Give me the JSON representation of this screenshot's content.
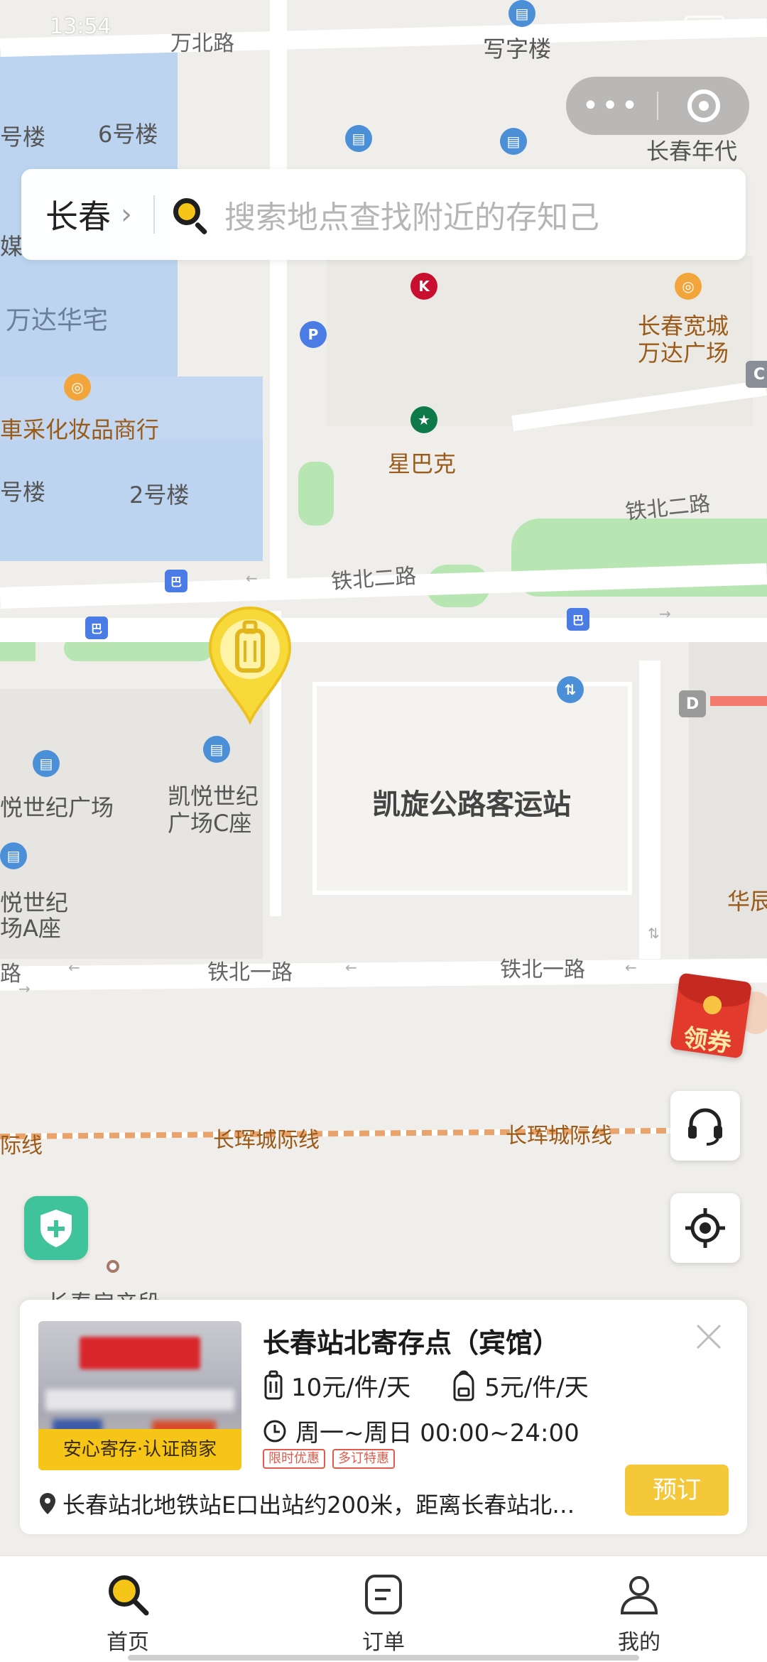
{
  "status_bar": {
    "time": "13:54"
  },
  "search": {
    "city": "长春",
    "placeholder": "搜索地点查找附近的存知己"
  },
  "map": {
    "labels": {
      "wanbei_road": "万北路",
      "office": "写字楼",
      "bldg_6": "6号楼",
      "bldg_x_left": "号楼",
      "changchun_niandai": "长春年代",
      "wanda_huazhai": "万达华宅",
      "kuancheng_wanda": "长春宽城万达广场",
      "kuancheng_line1": "长春宽城",
      "kuancheng_line2": "万达广场",
      "cosmetics": "車采化妆品商行",
      "starbucks": "星巴克",
      "bldg_2": "2号楼",
      "bldg_left2": "号楼",
      "tiebei_2_road": "铁北二路",
      "kaiyue_plaza": "悦世纪广场",
      "kaiyue_c_line1": "凯悦世纪",
      "kaiyue_c_line2": "广场C座",
      "kaixuan_station": "凯旋公路客运站",
      "kaiyue_a_line1": "悦世纪",
      "kaiyue_a_line2": "场A座",
      "huachen": "华辰",
      "tiebei_1_road": "铁北一路",
      "road_left": "路",
      "intercity": "长珲城际线",
      "intercity_left": "际线",
      "changchun_station_bottom": "长春房产段",
      "letter_d": "D",
      "letter_c": "C",
      "media_left": "媒"
    }
  },
  "coupon": {
    "label": "领券"
  },
  "shop": {
    "name": "长春站北寄存点（宾馆）",
    "photo_badge": "安心寄存·认证商家",
    "price_luggage": "10元/件/天",
    "price_bag": "5元/件/天",
    "hours": "周一~周日 00:00~24:00",
    "tags": [
      "限时优惠",
      "多订特惠"
    ],
    "address": "长春站北地铁站E口出站约200米，距离长春站北…",
    "book_label": "预订"
  },
  "nav": {
    "items": [
      {
        "label": "首页",
        "icon": "search-icon"
      },
      {
        "label": "订单",
        "icon": "order-icon"
      },
      {
        "label": "我的",
        "icon": "user-icon"
      }
    ]
  },
  "colors": {
    "brand_yellow": "#f5c518",
    "accent_red": "#e45a4a",
    "shield_green": "#3fc39b",
    "map_water": "#b9d3ee",
    "map_green": "#b8e6b3"
  }
}
